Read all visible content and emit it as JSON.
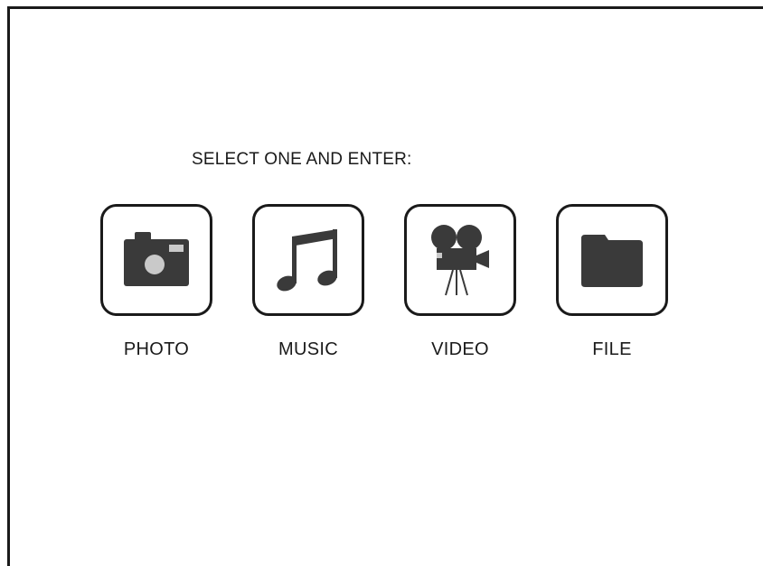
{
  "prompt": "SELECT ONE AND ENTER:",
  "menu": {
    "items": [
      {
        "label": "PHOTO",
        "icon": "camera-icon"
      },
      {
        "label": "MUSIC",
        "icon": "music-note-icon"
      },
      {
        "label": "VIDEO",
        "icon": "movie-camera-icon"
      },
      {
        "label": "FILE",
        "icon": "folder-icon"
      }
    ]
  },
  "colors": {
    "foreground": "#1a1a1a",
    "icon_fill": "#3a3a3a",
    "background": "#ffffff"
  }
}
